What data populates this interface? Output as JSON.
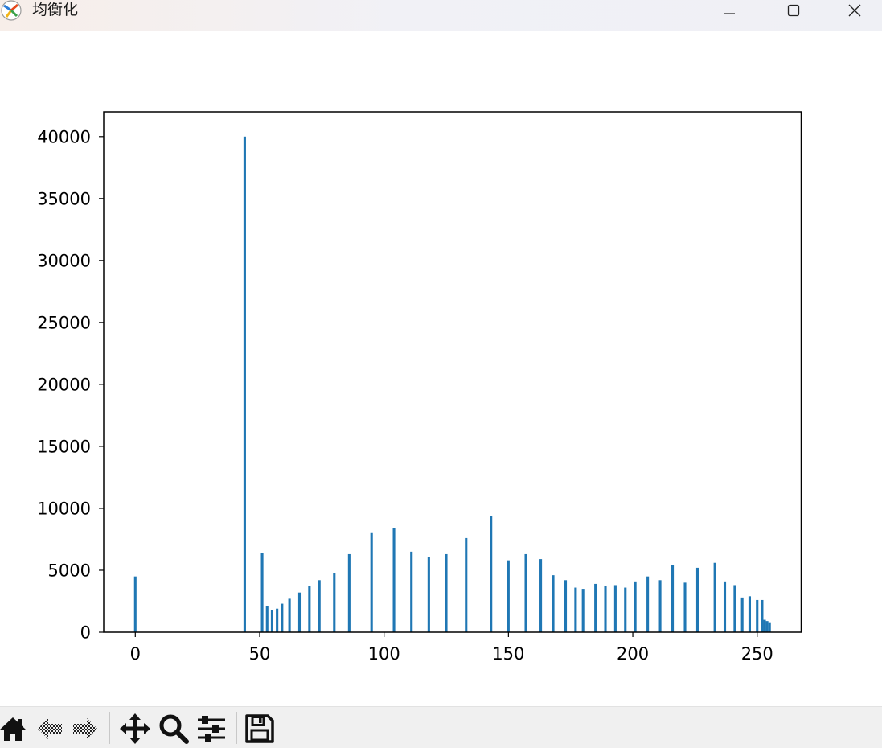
{
  "window": {
    "title": "均衡化",
    "controls": [
      "minimize",
      "maximize",
      "close"
    ]
  },
  "toolbar": {
    "tools": [
      "home-icon",
      "back-icon",
      "forward-icon",
      "pan-icon",
      "zoom-icon",
      "configure-subplots-icon",
      "save-icon"
    ]
  },
  "colors": {
    "bar": "#1f77b4",
    "axes": "#000000"
  },
  "chart_data": {
    "type": "bar",
    "title": "",
    "xlabel": "",
    "ylabel": "",
    "xlim": [
      -12.7,
      267.7
    ],
    "ylim": [
      0,
      42000
    ],
    "xticks": [
      0,
      50,
      100,
      150,
      200,
      250
    ],
    "xtick_labels": [
      "0",
      "50",
      "100",
      "150",
      "200",
      "250"
    ],
    "yticks": [
      0,
      5000,
      10000,
      15000,
      20000,
      25000,
      30000,
      35000,
      40000
    ],
    "ytick_labels": [
      "0",
      "5000",
      "10000",
      "15000",
      "20000",
      "25000",
      "30000",
      "35000",
      "40000"
    ],
    "grid": false,
    "legend": "none",
    "x": [
      0,
      44,
      51,
      53,
      55,
      57,
      59,
      62,
      66,
      70,
      74,
      80,
      86,
      95,
      104,
      111,
      118,
      125,
      133,
      143,
      150,
      157,
      163,
      168,
      173,
      177,
      180,
      185,
      189,
      193,
      197,
      201,
      206,
      211,
      216,
      221,
      226,
      233,
      237,
      241,
      244,
      247,
      250,
      252,
      253,
      254,
      255
    ],
    "values": [
      4500,
      40000,
      6400,
      2100,
      1800,
      1900,
      2300,
      2700,
      3200,
      3700,
      4200,
      4800,
      6300,
      8000,
      8400,
      6500,
      6100,
      6300,
      7600,
      9400,
      5800,
      6300,
      5900,
      4600,
      4200,
      3600,
      3500,
      3900,
      3700,
      3800,
      3600,
      4100,
      4500,
      4200,
      5400,
      4000,
      5200,
      5600,
      4100,
      3800,
      2800,
      2900,
      2600,
      2600,
      1000,
      900,
      800
    ]
  }
}
